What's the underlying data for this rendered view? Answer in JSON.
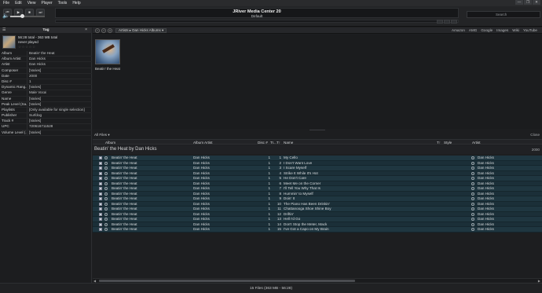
{
  "menu": [
    "File",
    "Edit",
    "View",
    "Player",
    "Tools",
    "Help"
  ],
  "window_controls": [
    "—",
    "❐",
    "✕"
  ],
  "transport": {
    "buttons": [
      "⏮",
      "▶",
      "■",
      "⏭"
    ],
    "display_title": "JRiver Media Center 20",
    "display_subtitle": "Default",
    "search_placeholder": "Search",
    "volume_level": 0.35
  },
  "tag_pane": {
    "title": "Tag",
    "summary_line1": "56:28 total - 363 MB total",
    "summary_line2": "never played",
    "stars": "☆☆☆☆☆",
    "fields": [
      {
        "name": "Album",
        "value": "Beatin' the Heat"
      },
      {
        "name": "Album Artist",
        "value": "Dan Hicks"
      },
      {
        "name": "Artist",
        "value": "Dan Hicks"
      },
      {
        "name": "Composer",
        "value": "[Varies]"
      },
      {
        "name": "Date",
        "value": "2000"
      },
      {
        "name": "Disc #",
        "value": "1"
      },
      {
        "name": "Dynamic Rang...",
        "value": "[Varies]"
      },
      {
        "name": "Genre",
        "value": "Male Vocal"
      },
      {
        "name": "Name",
        "value": "[Varies]"
      },
      {
        "name": "Peak Level (Sa...",
        "value": "[Varies]"
      },
      {
        "name": "Playlists",
        "value": "[Only available for single selection]"
      },
      {
        "name": "Publisher",
        "value": "Surfdog"
      },
      {
        "name": "Track #",
        "value": "[Varies]"
      },
      {
        "name": "UPC",
        "value": "720616711528"
      },
      {
        "name": "Volume Level (...",
        "value": "[Varies]"
      }
    ]
  },
  "nav": {
    "breadcrumb": "Artists ▸ Dan Hicks Albums ▾",
    "links": [
      "Amazon",
      "AMG",
      "Google",
      "Images",
      "Wiki",
      "YouTube"
    ]
  },
  "album": {
    "caption": "Beatin' the Heat"
  },
  "files": {
    "label": "All Files ▾",
    "close": "Close",
    "columns": [
      "Album",
      "Album Artist",
      "Disc #",
      "Tr...",
      "T↑",
      "Name",
      "T↑",
      "Style",
      "Artist"
    ],
    "group_title": "Beatin' the Heat by Dan Hicks",
    "group_year": "2000",
    "rows": [
      {
        "album": "Beatin' the Heat",
        "album_artist": "Dan Hicks",
        "disc": "1",
        "track": "1",
        "name": "My Cello",
        "artist": "Dan Hicks"
      },
      {
        "album": "Beatin' the Heat",
        "album_artist": "Dan Hicks",
        "disc": "1",
        "track": "2",
        "name": "I Don't Want Love",
        "artist": "Dan Hicks"
      },
      {
        "album": "Beatin' the Heat",
        "album_artist": "Dan Hicks",
        "disc": "1",
        "track": "3",
        "name": "I Scare Myself",
        "artist": "Dan Hicks"
      },
      {
        "album": "Beatin' the Heat",
        "album_artist": "Dan Hicks",
        "disc": "1",
        "track": "4",
        "name": "Strike It While It's Hot",
        "artist": "Dan Hicks"
      },
      {
        "album": "Beatin' the Heat",
        "album_artist": "Dan Hicks",
        "disc": "1",
        "track": "5",
        "name": "He Don't Care",
        "artist": "Dan Hicks"
      },
      {
        "album": "Beatin' the Heat",
        "album_artist": "Dan Hicks",
        "disc": "1",
        "track": "6",
        "name": "Meet Me on the Corner",
        "artist": "Dan Hicks"
      },
      {
        "album": "Beatin' the Heat",
        "album_artist": "Dan Hicks",
        "disc": "1",
        "track": "7",
        "name": "I'll Tell You Why That Is",
        "artist": "Dan Hicks"
      },
      {
        "album": "Beatin' the Heat",
        "album_artist": "Dan Hicks",
        "disc": "1",
        "track": "8",
        "name": "Hummin' to Myself",
        "artist": "Dan Hicks"
      },
      {
        "album": "Beatin' the Heat",
        "album_artist": "Dan Hicks",
        "disc": "1",
        "track": "9",
        "name": "Doin' It",
        "artist": "Dan Hicks"
      },
      {
        "album": "Beatin' the Heat",
        "album_artist": "Dan Hicks",
        "disc": "1",
        "track": "10",
        "name": "The Piano Has Been Drinkin'",
        "artist": "Dan Hicks"
      },
      {
        "album": "Beatin' the Heat",
        "album_artist": "Dan Hicks",
        "disc": "1",
        "track": "11",
        "name": "Chattanooga Shoe Shine Boy",
        "artist": "Dan Hicks"
      },
      {
        "album": "Beatin' the Heat",
        "album_artist": "Dan Hicks",
        "disc": "1",
        "track": "12",
        "name": "Driftin'",
        "artist": "Dan Hicks"
      },
      {
        "album": "Beatin' the Heat",
        "album_artist": "Dan Hicks",
        "disc": "1",
        "track": "13",
        "name": "Hell I'd Go",
        "artist": "Dan Hicks"
      },
      {
        "album": "Beatin' the Heat",
        "album_artist": "Dan Hicks",
        "disc": "1",
        "track": "14",
        "name": "Don't Stop the Meter, Mack",
        "artist": "Dan Hicks"
      },
      {
        "album": "Beatin' the Heat",
        "album_artist": "Dan Hicks",
        "disc": "1",
        "track": "15",
        "name": "I've Got a Capo on My Brain",
        "artist": "Dan Hicks"
      }
    ]
  },
  "status": "15 Files (363 MB - 56:28)"
}
